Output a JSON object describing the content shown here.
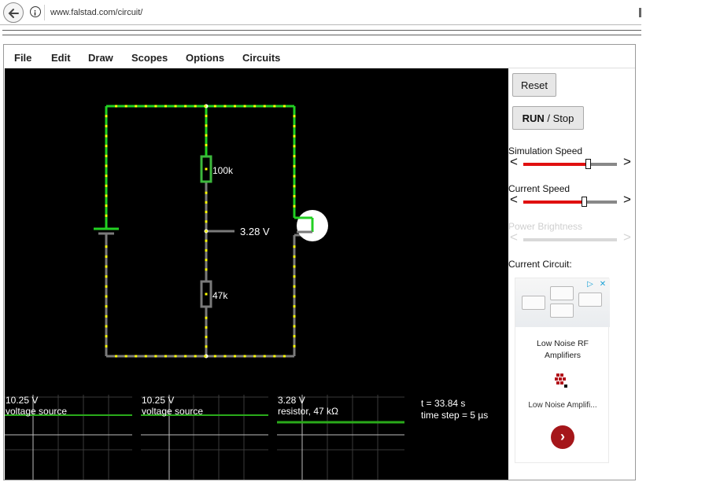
{
  "browser": {
    "url": "www.falstad.com/circuit/"
  },
  "menu": {
    "items": [
      "File",
      "Edit",
      "Draw",
      "Scopes",
      "Options",
      "Circuits"
    ]
  },
  "circuit": {
    "resistor_top_label": "100k",
    "resistor_bottom_label": "47k",
    "probe_label": "3.28 V"
  },
  "scopes": [
    {
      "value": "10.25 V",
      "label": "voltage source"
    },
    {
      "value": "10.25 V",
      "label": "voltage source"
    },
    {
      "value": "3.28 V",
      "label": "resistor, 47 kΩ"
    }
  ],
  "status": {
    "time": "t = 33.84 s",
    "timestep": "time step = 5 µs"
  },
  "panel": {
    "reset_label": "Reset",
    "run_label": "RUN",
    "stop_label": " / Stop",
    "sim_speed_label": "Simulation Speed",
    "sim_speed_value": 0.69,
    "current_speed_label": "Current Speed",
    "current_speed_value": 0.65,
    "power_brightness_label": "Power Brightness",
    "current_circuit_label": "Current Circuit:",
    "arrow_left": "<",
    "arrow_right": ">"
  },
  "ad": {
    "title_line1": "Low Noise RF",
    "title_line2": "Amplifiers",
    "subtitle": "Low Noise Amplifi...",
    "close_glyph": "✕",
    "choices_glyph": "▷",
    "go_glyph": "›"
  },
  "colors": {
    "wire_green": "#22d022",
    "wire_gray": "#7a7a7a",
    "current_dot": "#ffff00",
    "trace_green": "#2aaa1a",
    "accent_red": "#e01010"
  }
}
